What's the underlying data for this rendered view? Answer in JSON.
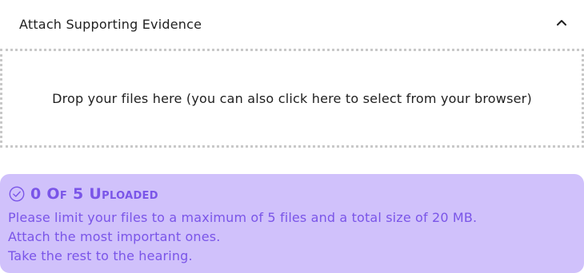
{
  "section": {
    "title": "Attach Supporting Evidence",
    "collapse_icon": "chevron-up-icon"
  },
  "dropzone": {
    "text": "Drop your files here (you can also click here to select from your browser)"
  },
  "upload_status": {
    "icon": "check-circle-icon",
    "text": "0 Of 5 Uploaded",
    "uploaded_count": 0,
    "max_count": 5,
    "notes": [
      "Please limit your files to a maximum of 5 files and a total size of 20 MB.",
      "Attach the most important ones.",
      "Take the rest to the hearing."
    ]
  },
  "colors": {
    "panel_background": "#d0c1fb",
    "accent_text": "#7a55e8",
    "dropzone_border": "#c8c8c8"
  }
}
